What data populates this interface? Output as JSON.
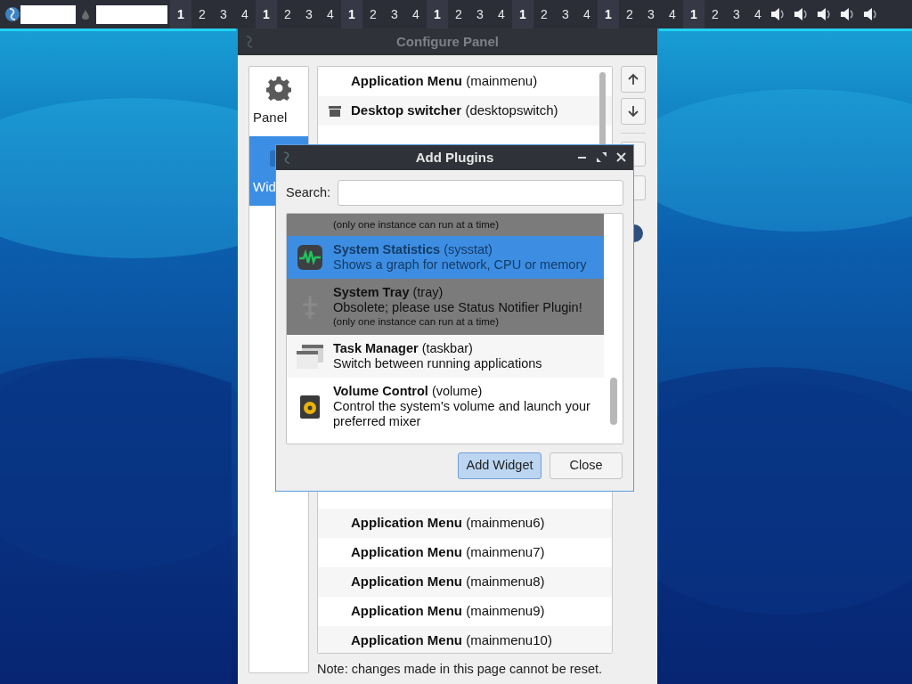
{
  "taskbar": {
    "desktop_groups": [
      {
        "desks": [
          {
            "label": "1",
            "selected": true
          },
          {
            "label": "2",
            "selected": false
          },
          {
            "label": "3",
            "selected": false
          },
          {
            "label": "4",
            "selected": false
          }
        ]
      },
      {
        "desks": [
          {
            "label": "1",
            "selected": true
          },
          {
            "label": "2",
            "selected": false
          },
          {
            "label": "3",
            "selected": false
          },
          {
            "label": "4",
            "selected": false
          }
        ]
      },
      {
        "desks": [
          {
            "label": "1",
            "selected": true
          },
          {
            "label": "2",
            "selected": false
          },
          {
            "label": "3",
            "selected": false
          },
          {
            "label": "4",
            "selected": false
          }
        ]
      },
      {
        "desks": [
          {
            "label": "1",
            "selected": true
          },
          {
            "label": "2",
            "selected": false
          },
          {
            "label": "3",
            "selected": false
          },
          {
            "label": "4",
            "selected": false
          }
        ]
      },
      {
        "desks": [
          {
            "label": "1",
            "selected": true
          },
          {
            "label": "2",
            "selected": false
          },
          {
            "label": "3",
            "selected": false
          },
          {
            "label": "4",
            "selected": false
          }
        ]
      },
      {
        "desks": [
          {
            "label": "1",
            "selected": true
          },
          {
            "label": "2",
            "selected": false
          },
          {
            "label": "3",
            "selected": false
          },
          {
            "label": "4",
            "selected": false
          }
        ]
      },
      {
        "desks": [
          {
            "label": "1",
            "selected": true
          },
          {
            "label": "2",
            "selected": false
          },
          {
            "label": "3",
            "selected": false
          },
          {
            "label": "4",
            "selected": false
          }
        ]
      }
    ],
    "tray_icons": [
      {
        "kind": "volume"
      },
      {
        "kind": "volume"
      },
      {
        "kind": "volume"
      },
      {
        "kind": "volume"
      },
      {
        "kind": "volume"
      }
    ]
  },
  "configure_window": {
    "title": "Configure Panel",
    "sidebar": [
      {
        "label": "Panel",
        "kind": "panel",
        "selected": false
      },
      {
        "label": "Wid",
        "kind": "widgets",
        "selected": true
      }
    ],
    "widgets_top": [
      {
        "name": "Application Menu",
        "id": "(mainmenu)"
      },
      {
        "name": "Desktop switcher",
        "id": "(desktopswitch)",
        "kind": "desktop"
      }
    ],
    "widgets_bottom": [
      {
        "name": "Application Menu",
        "id": "(mainmenu6)"
      },
      {
        "name": "Application Menu",
        "id": "(mainmenu7)"
      },
      {
        "name": "Application Menu",
        "id": "(mainmenu8)"
      },
      {
        "name": "Application Menu",
        "id": "(mainmenu9)"
      },
      {
        "name": "Application Menu",
        "id": "(mainmenu10)"
      }
    ],
    "note": "Note: changes made in this page cannot be reset."
  },
  "add_plugins": {
    "title": "Add Plugins",
    "search_label": "Search:",
    "plugins": [
      {
        "kind": "partial",
        "lines": [
          "(only one instance can run at a time)"
        ],
        "selected": false,
        "disabled": true
      },
      {
        "kind": "sysstat",
        "name": "System Statistics",
        "id": "(sysstat)",
        "lines": [
          "Shows a graph for network, CPU or memory"
        ],
        "selected": true,
        "disabled": false
      },
      {
        "kind": "tray",
        "name": "System Tray",
        "id": "(tray)",
        "lines": [
          "Obsolete; please use Status Notifier Plugin!",
          "(only one instance can run at a time)"
        ],
        "selected": false,
        "disabled": true
      },
      {
        "kind": "taskbar",
        "name": "Task Manager",
        "id": "(taskbar)",
        "lines": [
          "Switch between running applications"
        ],
        "selected": false,
        "disabled": false
      },
      {
        "kind": "volume",
        "name": "Volume Control",
        "id": "(volume)",
        "lines": [
          "Control the system's volume and launch your preferred mixer"
        ],
        "selected": false,
        "disabled": false
      }
    ],
    "buttons": [
      {
        "label": "Add Widget",
        "selected": true
      },
      {
        "label": "Close",
        "selected": false
      }
    ]
  }
}
